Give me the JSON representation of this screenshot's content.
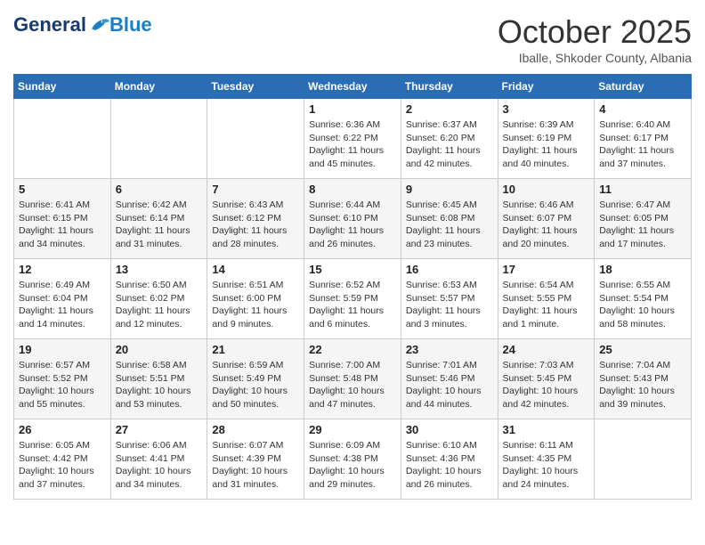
{
  "header": {
    "logo_general": "General",
    "logo_blue": "Blue",
    "month_title": "October 2025",
    "location": "Iballe, Shkoder County, Albania"
  },
  "weekdays": [
    "Sunday",
    "Monday",
    "Tuesday",
    "Wednesday",
    "Thursday",
    "Friday",
    "Saturday"
  ],
  "weeks": [
    [
      {
        "day": "",
        "info": ""
      },
      {
        "day": "",
        "info": ""
      },
      {
        "day": "",
        "info": ""
      },
      {
        "day": "1",
        "info": "Sunrise: 6:36 AM\nSunset: 6:22 PM\nDaylight: 11 hours and 45 minutes."
      },
      {
        "day": "2",
        "info": "Sunrise: 6:37 AM\nSunset: 6:20 PM\nDaylight: 11 hours and 42 minutes."
      },
      {
        "day": "3",
        "info": "Sunrise: 6:39 AM\nSunset: 6:19 PM\nDaylight: 11 hours and 40 minutes."
      },
      {
        "day": "4",
        "info": "Sunrise: 6:40 AM\nSunset: 6:17 PM\nDaylight: 11 hours and 37 minutes."
      }
    ],
    [
      {
        "day": "5",
        "info": "Sunrise: 6:41 AM\nSunset: 6:15 PM\nDaylight: 11 hours and 34 minutes."
      },
      {
        "day": "6",
        "info": "Sunrise: 6:42 AM\nSunset: 6:14 PM\nDaylight: 11 hours and 31 minutes."
      },
      {
        "day": "7",
        "info": "Sunrise: 6:43 AM\nSunset: 6:12 PM\nDaylight: 11 hours and 28 minutes."
      },
      {
        "day": "8",
        "info": "Sunrise: 6:44 AM\nSunset: 6:10 PM\nDaylight: 11 hours and 26 minutes."
      },
      {
        "day": "9",
        "info": "Sunrise: 6:45 AM\nSunset: 6:08 PM\nDaylight: 11 hours and 23 minutes."
      },
      {
        "day": "10",
        "info": "Sunrise: 6:46 AM\nSunset: 6:07 PM\nDaylight: 11 hours and 20 minutes."
      },
      {
        "day": "11",
        "info": "Sunrise: 6:47 AM\nSunset: 6:05 PM\nDaylight: 11 hours and 17 minutes."
      }
    ],
    [
      {
        "day": "12",
        "info": "Sunrise: 6:49 AM\nSunset: 6:04 PM\nDaylight: 11 hours and 14 minutes."
      },
      {
        "day": "13",
        "info": "Sunrise: 6:50 AM\nSunset: 6:02 PM\nDaylight: 11 hours and 12 minutes."
      },
      {
        "day": "14",
        "info": "Sunrise: 6:51 AM\nSunset: 6:00 PM\nDaylight: 11 hours and 9 minutes."
      },
      {
        "day": "15",
        "info": "Sunrise: 6:52 AM\nSunset: 5:59 PM\nDaylight: 11 hours and 6 minutes."
      },
      {
        "day": "16",
        "info": "Sunrise: 6:53 AM\nSunset: 5:57 PM\nDaylight: 11 hours and 3 minutes."
      },
      {
        "day": "17",
        "info": "Sunrise: 6:54 AM\nSunset: 5:55 PM\nDaylight: 11 hours and 1 minute."
      },
      {
        "day": "18",
        "info": "Sunrise: 6:55 AM\nSunset: 5:54 PM\nDaylight: 10 hours and 58 minutes."
      }
    ],
    [
      {
        "day": "19",
        "info": "Sunrise: 6:57 AM\nSunset: 5:52 PM\nDaylight: 10 hours and 55 minutes."
      },
      {
        "day": "20",
        "info": "Sunrise: 6:58 AM\nSunset: 5:51 PM\nDaylight: 10 hours and 53 minutes."
      },
      {
        "day": "21",
        "info": "Sunrise: 6:59 AM\nSunset: 5:49 PM\nDaylight: 10 hours and 50 minutes."
      },
      {
        "day": "22",
        "info": "Sunrise: 7:00 AM\nSunset: 5:48 PM\nDaylight: 10 hours and 47 minutes."
      },
      {
        "day": "23",
        "info": "Sunrise: 7:01 AM\nSunset: 5:46 PM\nDaylight: 10 hours and 44 minutes."
      },
      {
        "day": "24",
        "info": "Sunrise: 7:03 AM\nSunset: 5:45 PM\nDaylight: 10 hours and 42 minutes."
      },
      {
        "day": "25",
        "info": "Sunrise: 7:04 AM\nSunset: 5:43 PM\nDaylight: 10 hours and 39 minutes."
      }
    ],
    [
      {
        "day": "26",
        "info": "Sunrise: 6:05 AM\nSunset: 4:42 PM\nDaylight: 10 hours and 37 minutes."
      },
      {
        "day": "27",
        "info": "Sunrise: 6:06 AM\nSunset: 4:41 PM\nDaylight: 10 hours and 34 minutes."
      },
      {
        "day": "28",
        "info": "Sunrise: 6:07 AM\nSunset: 4:39 PM\nDaylight: 10 hours and 31 minutes."
      },
      {
        "day": "29",
        "info": "Sunrise: 6:09 AM\nSunset: 4:38 PM\nDaylight: 10 hours and 29 minutes."
      },
      {
        "day": "30",
        "info": "Sunrise: 6:10 AM\nSunset: 4:36 PM\nDaylight: 10 hours and 26 minutes."
      },
      {
        "day": "31",
        "info": "Sunrise: 6:11 AM\nSunset: 4:35 PM\nDaylight: 10 hours and 24 minutes."
      },
      {
        "day": "",
        "info": ""
      }
    ]
  ]
}
